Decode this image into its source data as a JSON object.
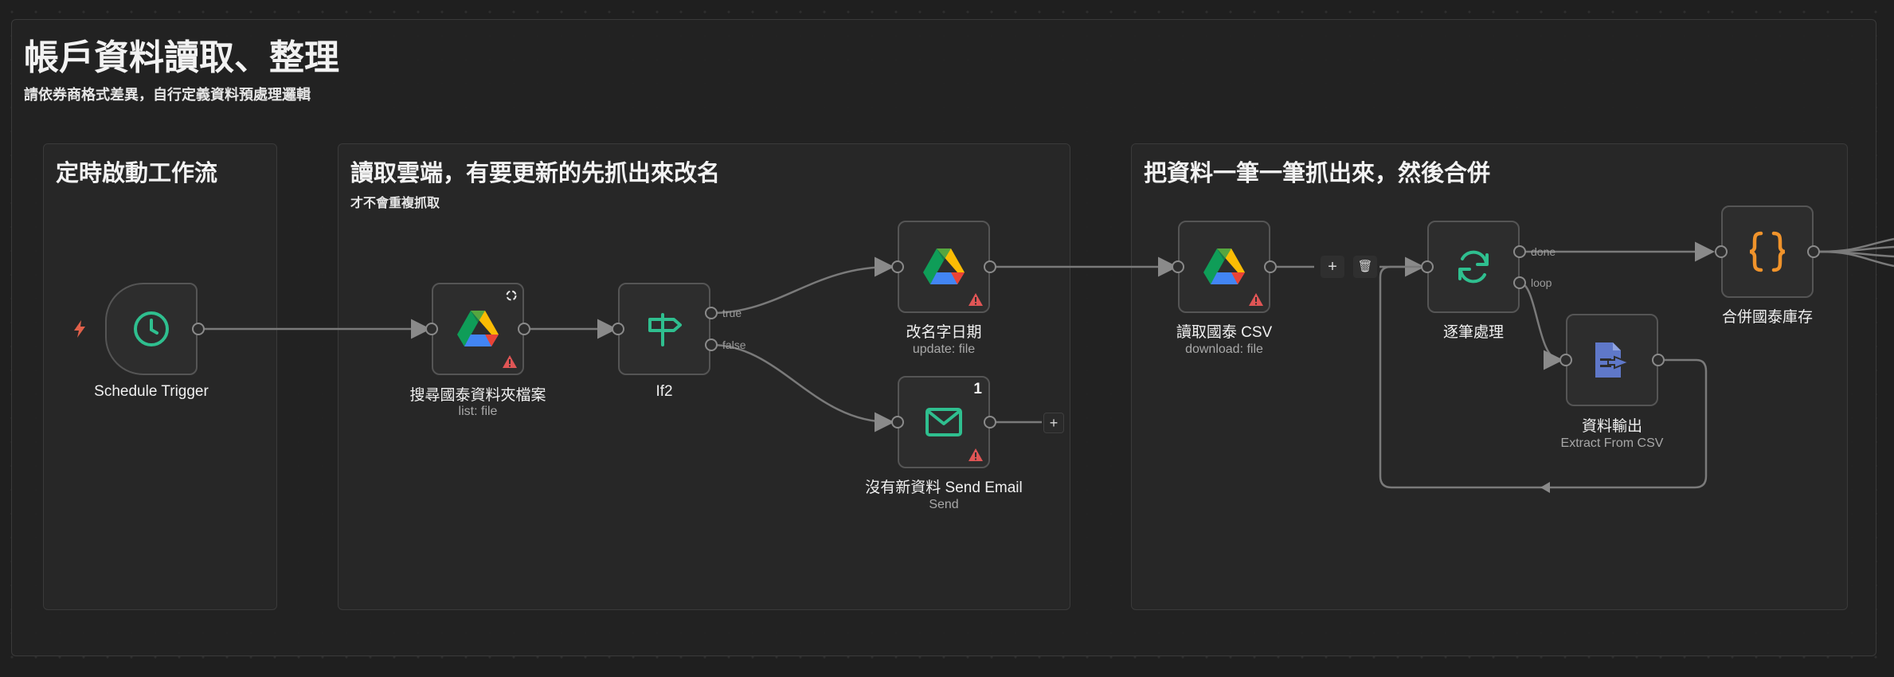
{
  "canvas": {
    "main_sticky": {
      "title": "帳戶資料讀取、整理",
      "subtitle": "請依券商格式差異，自行定義資料預處理邏輯"
    },
    "groups": [
      {
        "title": "定時啟動工作流",
        "subtitle": ""
      },
      {
        "title": "讀取雲端，有要更新的先抓出來改名",
        "subtitle": "才不會重複抓取"
      },
      {
        "title": "把資料一筆一筆抓出來，然後合併",
        "subtitle": ""
      }
    ],
    "nodes": {
      "schedule": {
        "label": "Schedule Trigger",
        "sub": "",
        "icon": "clock-icon"
      },
      "search": {
        "label": "搜尋國泰資料夾檔案",
        "sub": "list: file",
        "icon": "google-drive-icon"
      },
      "if2": {
        "label": "If2",
        "sub": "",
        "icon": "signpost-icon",
        "true_label": "true",
        "false_label": "false"
      },
      "rename": {
        "label": "改名字日期",
        "sub": "update: file",
        "icon": "google-drive-icon"
      },
      "email": {
        "label": "沒有新資料 Send Email",
        "sub": "Send",
        "icon": "envelope-icon",
        "badge": "1"
      },
      "read_csv": {
        "label": "讀取國泰 CSV",
        "sub": "download: file",
        "icon": "google-drive-icon"
      },
      "loop": {
        "label": "逐筆處理",
        "sub": "",
        "icon": "refresh-icon",
        "done_label": "done",
        "loop_label": "loop"
      },
      "extract": {
        "label": "資料輸出",
        "sub": "Extract From CSV",
        "icon": "file-export-icon"
      },
      "merge": {
        "label": "合併國泰庫存",
        "sub": "",
        "icon": "code-braces-icon"
      }
    },
    "edge_toolbar": {
      "add": "+",
      "delete": "🗑"
    },
    "email_add": "+",
    "colors": {
      "accent_green": "#2fbf8f",
      "warning_red": "#e05555",
      "trigger_bolt": "#e0604a",
      "code_orange": "#f0932b",
      "extract_blue": "#5f78c9"
    }
  }
}
